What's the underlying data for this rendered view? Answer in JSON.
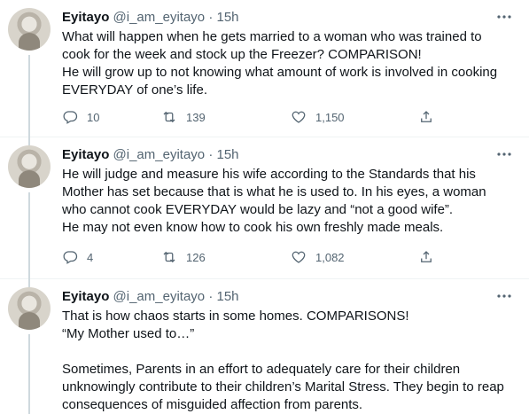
{
  "tweets": [
    {
      "name": "Eyitayo",
      "handle": "@i_am_eyitayo",
      "dot": "·",
      "time": "15h",
      "lines": [
        "What will happen when he gets married to a woman who was trained to",
        "cook for the week and stock up the Freezer? COMPARISON!",
        "He will grow up to not knowing what amount of work is involved in cooking",
        "EVERYDAY of one’s life."
      ],
      "replies": "10",
      "retweets": "139",
      "likes": "1,150"
    },
    {
      "name": "Eyitayo",
      "handle": "@i_am_eyitayo",
      "dot": "·",
      "time": "15h",
      "lines": [
        "He will judge and measure his wife according to the Standards that his",
        "Mother has set because that is what he is used to. In his eyes, a woman",
        "who cannot cook EVERYDAY would be lazy and “not a good wife”.",
        "He may not even know how to cook his own freshly made meals."
      ],
      "replies": "4",
      "retweets": "126",
      "likes": "1,082"
    },
    {
      "name": "Eyitayo",
      "handle": "@i_am_eyitayo",
      "dot": "·",
      "time": "15h",
      "lines": [
        "That is how chaos starts in some homes. COMPARISONS!",
        "“My Mother used to…”",
        "",
        "Sometimes, Parents in an effort to adequately care for their children",
        "unknowingly contribute to their children’s Marital Stress. They begin to reap",
        "consequences of misguided affection from parents."
      ]
    }
  ],
  "icons": {
    "more": "more-icon",
    "reply": "reply-icon",
    "retweet": "retweet-icon",
    "like": "heart-icon",
    "share": "share-icon"
  },
  "colors": {
    "text": "#0f1419",
    "secondary": "#536471",
    "divider": "#eff3f4",
    "thread_line": "#cfd9de"
  }
}
